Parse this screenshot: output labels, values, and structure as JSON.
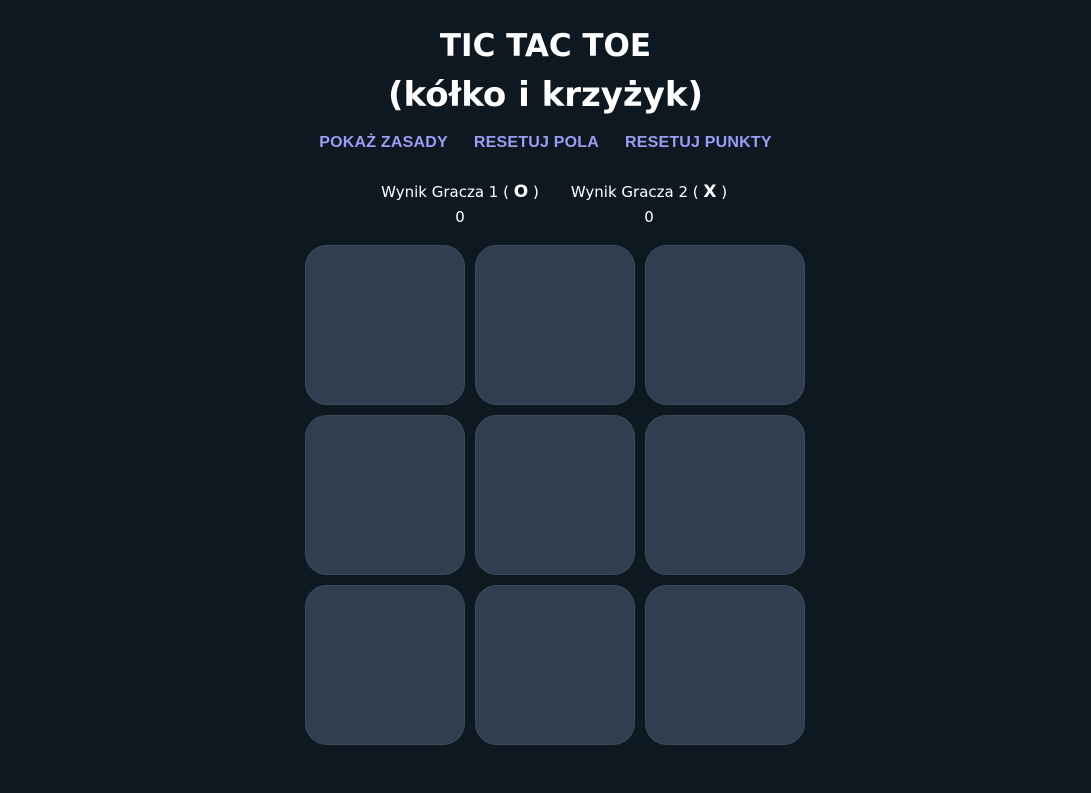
{
  "header": {
    "title_line1": "TIC TAC TOE",
    "title_line2": "(kółko i krzyżyk)"
  },
  "nav": {
    "show_rules": "POKAŻ ZASADY",
    "reset_board": "RESETUJ POLA",
    "reset_score": "RESETUJ PUNKTY"
  },
  "scores": {
    "player1": {
      "label_prefix": "Wynik Gracza 1 ( ",
      "symbol": "O",
      "label_suffix": " )",
      "value": "0"
    },
    "player2": {
      "label_prefix": "Wynik Gracza 2 ( ",
      "symbol": "X",
      "label_suffix": " )",
      "value": "0"
    }
  },
  "board": {
    "cells": [
      "",
      "",
      "",
      "",
      "",
      "",
      "",
      "",
      ""
    ]
  },
  "colors": {
    "background": "#0e1820",
    "cell": "#2f3f50",
    "link": "#9b9cf5",
    "text": "#ffffff"
  }
}
